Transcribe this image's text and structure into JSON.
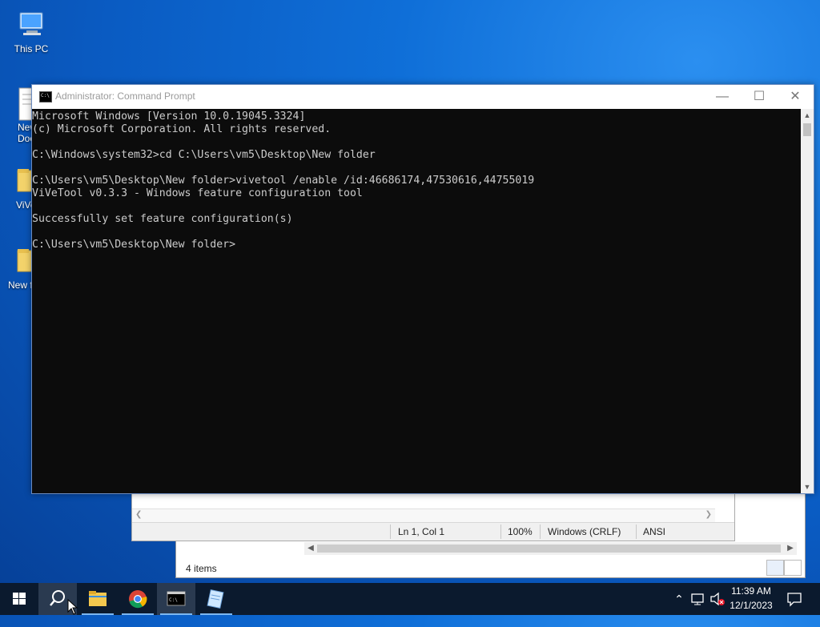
{
  "desktop": {
    "icons": [
      {
        "label": "This PC"
      },
      {
        "label": "New\nDocu"
      },
      {
        "label": "ViVeToo"
      },
      {
        "label": "New f"
      }
    ]
  },
  "cmd": {
    "title": "Administrator: Command Prompt",
    "lines": [
      "Microsoft Windows [Version 10.0.19045.3324]",
      "(c) Microsoft Corporation. All rights reserved.",
      "",
      "C:\\Windows\\system32>cd C:\\Users\\vm5\\Desktop\\New folder",
      "",
      "C:\\Users\\vm5\\Desktop\\New folder>vivetool /enable /id:46686174,47530616,44755019",
      "ViVeTool v0.3.3 - Windows feature configuration tool",
      "",
      "Successfully set feature configuration(s)",
      "",
      "C:\\Users\\vm5\\Desktop\\New folder>"
    ],
    "buttons": {
      "minimize": "—",
      "maximize": "☐",
      "close": "✕"
    }
  },
  "notepad": {
    "status": {
      "position": "Ln 1, Col 1",
      "zoom": "100%",
      "line_endings": "Windows (CRLF)",
      "encoding": "ANSI"
    }
  },
  "explorer": {
    "item_count": "4 items"
  },
  "taskbar": {
    "apps": [
      {
        "name": "start",
        "icon": "windows-logo-icon"
      },
      {
        "name": "search",
        "icon": "search-icon"
      },
      {
        "name": "file-explorer",
        "icon": "folder-icon"
      },
      {
        "name": "chrome",
        "icon": "chrome-icon"
      },
      {
        "name": "command-prompt",
        "icon": "cmd-icon"
      },
      {
        "name": "notepad",
        "icon": "notepad-icon"
      }
    ],
    "clock": {
      "time": "11:39 AM",
      "date": "12/1/2023"
    }
  },
  "colors": {
    "console_bg": "#0c0c0c",
    "console_fg": "#cccccc",
    "taskbar_bg": "#0b1a2e"
  }
}
